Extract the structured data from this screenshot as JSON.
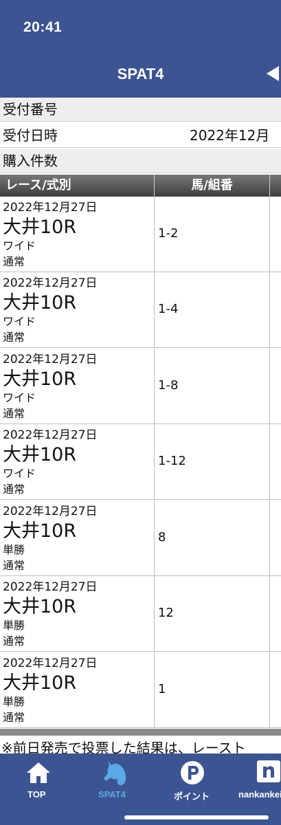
{
  "status_bar": {
    "time": "20:41"
  },
  "header": {
    "title": "SPAT4",
    "back_icon": "triangle-left-icon"
  },
  "info": {
    "receipt_number_label": "受付番号",
    "receipt_number_value": "",
    "receipt_datetime_label": "受付日時",
    "receipt_datetime_value": "2022年12月",
    "purchase_count_label": "購入件数"
  },
  "table": {
    "headers": {
      "race": "レース/式別",
      "horse": "馬/組番"
    },
    "rows": [
      {
        "date": "2022年12月27日",
        "venue": "大井10R",
        "bet_type": "ワイド",
        "kind": "通常",
        "horses": "1-2"
      },
      {
        "date": "2022年12月27日",
        "venue": "大井10R",
        "bet_type": "ワイド",
        "kind": "通常",
        "horses": "1-4"
      },
      {
        "date": "2022年12月27日",
        "venue": "大井10R",
        "bet_type": "ワイド",
        "kind": "通常",
        "horses": "1-8"
      },
      {
        "date": "2022年12月27日",
        "venue": "大井10R",
        "bet_type": "ワイド",
        "kind": "通常",
        "horses": "1-12"
      },
      {
        "date": "2022年12月27日",
        "venue": "大井10R",
        "bet_type": "単勝",
        "kind": "通常",
        "horses": "8"
      },
      {
        "date": "2022年12月27日",
        "venue": "大井10R",
        "bet_type": "単勝",
        "kind": "通常",
        "horses": "12"
      },
      {
        "date": "2022年12月27日",
        "venue": "大井10R",
        "bet_type": "単勝",
        "kind": "通常",
        "horses": "1"
      }
    ]
  },
  "notice": "※前日発売で投票した結果は、レースト",
  "tabbar": {
    "items": [
      {
        "label": "TOP",
        "icon": "home-icon",
        "active": false
      },
      {
        "label": "SPAT4",
        "icon": "horse-head-icon",
        "active": true
      },
      {
        "label": "ポイント",
        "icon": "p-circle-icon",
        "active": false
      },
      {
        "label": "nankankeiba",
        "icon": "n-square-icon",
        "active": false
      }
    ]
  },
  "colors": {
    "header_bg": "#3c5491",
    "active_tab": "#5aa9e6",
    "table_header": "#555555"
  }
}
